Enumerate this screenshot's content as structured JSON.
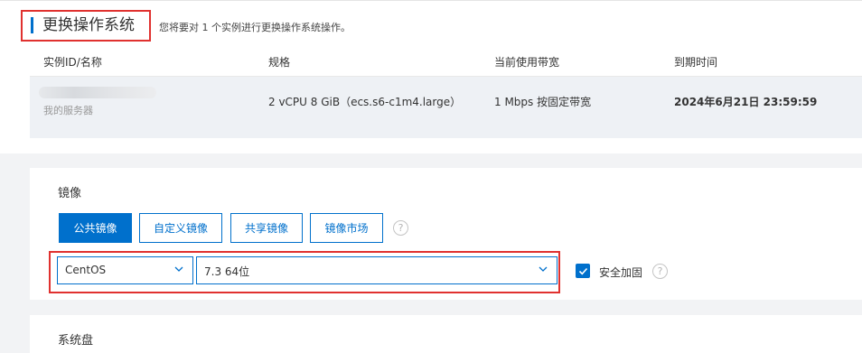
{
  "header": {
    "title": "更换操作系统",
    "subtitle": "您将要对 1 个实例进行更换操作系统操作。"
  },
  "instance_table": {
    "columns": [
      "实例ID/名称",
      "规格",
      "当前使用带宽",
      "到期时间"
    ],
    "row": {
      "instance_name": "我的服务器",
      "spec": "2 vCPU 8 GiB（ecs.s6-c1m4.large）",
      "bandwidth": "1 Mbps 按固定带宽",
      "expiry": "2024年6月21日 23:59:59"
    }
  },
  "image_section": {
    "label": "镜像",
    "tabs": [
      {
        "label": "公共镜像",
        "active": true
      },
      {
        "label": "自定义镜像",
        "active": false
      },
      {
        "label": "共享镜像",
        "active": false
      },
      {
        "label": "镜像市场",
        "active": false
      }
    ],
    "help_icon": "question-circle-icon",
    "os_select": {
      "value": "CentOS"
    },
    "version_select": {
      "value": "7.3 64位"
    },
    "security_hardening": {
      "label": "安全加固",
      "checked": true
    }
  },
  "system_disk": {
    "label": "系统盘"
  },
  "colors": {
    "accent": "#0070cc",
    "highlight_border": "#e0312f"
  }
}
